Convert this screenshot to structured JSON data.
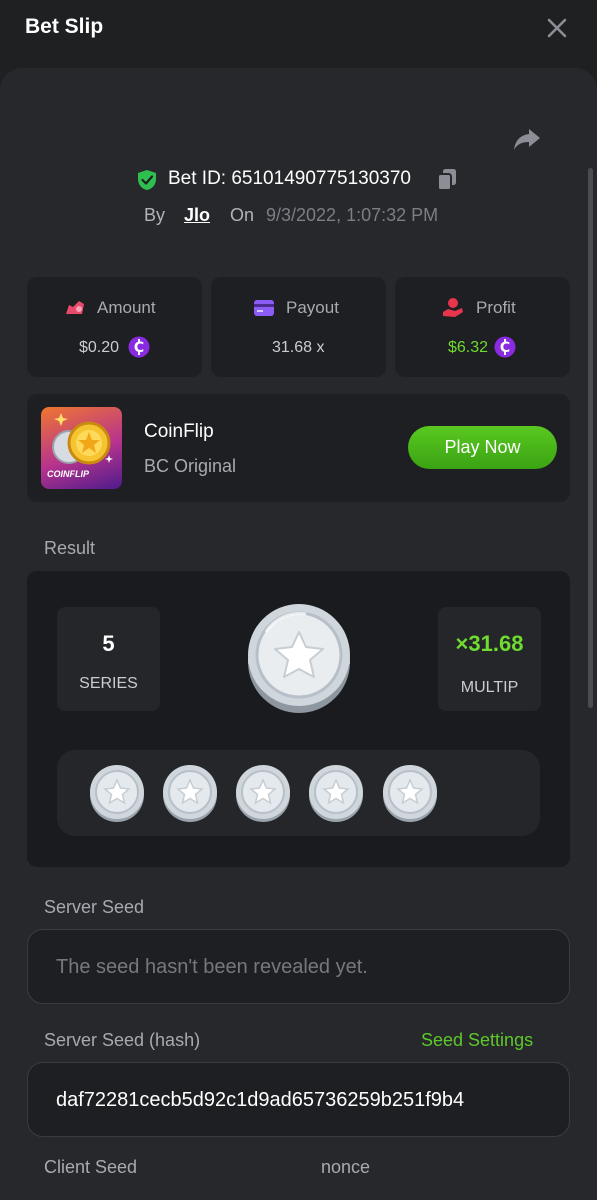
{
  "header": {
    "title": "Bet Slip",
    "close_icon": "close-icon"
  },
  "bet": {
    "id_text": "Bet ID: 65101490775130370",
    "by_label": "By",
    "user": "Jlo",
    "on_label": "On",
    "date": "9/3/2022, 1:07:32 PM"
  },
  "stats": {
    "amount": {
      "label": "Amount",
      "value": "$0.20",
      "icon": "money-bag-icon"
    },
    "payout": {
      "label": "Payout",
      "value": "31.68 x",
      "icon": "card-icon"
    },
    "profit": {
      "label": "Profit",
      "value": "$6.32",
      "icon": "hand-coin-icon"
    }
  },
  "game": {
    "name": "CoinFlip",
    "provider": "BC Original",
    "thumb_label": "COINFLIP",
    "play_label": "Play Now"
  },
  "result": {
    "section_label": "Result",
    "series_value": "5",
    "series_label": "SERIES",
    "multiplier_value": "×31.68",
    "multiplier_label": "MULTIP",
    "coin_count": 5
  },
  "server_seed": {
    "label": "Server Seed",
    "value": "The seed hasn't been revealed yet."
  },
  "server_seed_hash": {
    "label": "Server Seed (hash)",
    "settings_link": "Seed Settings",
    "value": "daf72281cecb5d92c1d9ad65736259b251f9b4"
  },
  "client_seed": {
    "label": "Client Seed"
  },
  "nonce": {
    "label": "nonce"
  },
  "colors": {
    "accent_green": "#6fdb2f",
    "button_green": "#4cb61b",
    "shield_green": "#2fbf4f",
    "currency_purple": "#8a2be2",
    "background": "#1f2022",
    "panel": "#26282c"
  }
}
